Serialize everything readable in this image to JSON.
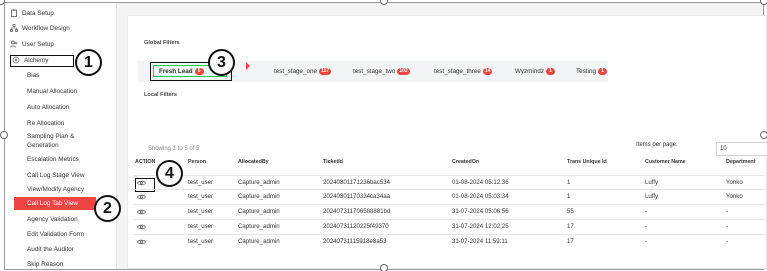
{
  "sidebar": {
    "top_items": [
      {
        "label": "Data Setup",
        "icon": "clipboard-icon"
      },
      {
        "label": "Workflow Design",
        "icon": "workflow-icon"
      },
      {
        "label": "User Setup",
        "icon": "users-icon"
      },
      {
        "label": "Alchemy",
        "icon": "alchemy-icon"
      }
    ],
    "sub_items": [
      "Bias",
      "Manual Allocation",
      "Auto Allocation",
      "Re Allocation",
      "Sampling Plan &",
      "Generation",
      "Escalation Metrics",
      "Call Log Stage View",
      "View/Modify Agency",
      "Call Log Tab View",
      "Agency Validation",
      "Edit Validation Form",
      "Audit the Auditor",
      "Skip Reason"
    ]
  },
  "main": {
    "global_filters_label": "Global Filters",
    "local_filters_label": "Local Filters",
    "chips": [
      {
        "label": "Fresh Lead",
        "count": "5"
      },
      {
        "label": "test_stage_one",
        "count": "117"
      },
      {
        "label": "test_stage_two",
        "count": "102"
      },
      {
        "label": "test_stage_three",
        "count": "14"
      },
      {
        "label": "Wyzmindz",
        "count": "1"
      },
      {
        "label": "Testing",
        "count": "1"
      }
    ],
    "showing": "Showing 1 to 5 of 5",
    "items_per_page_label": "Items per page:",
    "items_per_page_value": "10"
  },
  "table": {
    "headers": [
      "ACTION",
      "Person",
      "AllocatedBy",
      "TicketId",
      "CreatedOn",
      "Trans Unique Id",
      "Customer Name",
      "Department"
    ],
    "rows": [
      {
        "person": "test_user",
        "allocated_by": "Capture_admin",
        "ticket": "20240801171236bac534",
        "created": "01-08-2024 05:12:36",
        "trans": "1",
        "customer": "Luffy",
        "dept": "Yonko"
      },
      {
        "person": "test_user",
        "allocated_by": "Capture_admin",
        "ticket": "20240801170334ca34aa",
        "created": "01-08-2024 05:03:34",
        "trans": "1",
        "customer": "Luffy",
        "dept": "Yonko"
      },
      {
        "person": "test_user",
        "allocated_by": "Capture_admin",
        "ticket": "202407311706588881bd",
        "created": "31-07-2024 05:06:56",
        "trans": "55",
        "customer": "-",
        "dept": "-"
      },
      {
        "person": "test_user",
        "allocated_by": "Capture_admin",
        "ticket": "20240731120225f49370",
        "created": "31-07-2024 12:02:25",
        "trans": "17",
        "customer": "-",
        "dept": "-"
      },
      {
        "person": "test_user",
        "allocated_by": "Capture_admin",
        "ticket": "2024073111591​8e8a53",
        "created": "31-07-2024 11:59:11",
        "trans": "17",
        "customer": "-",
        "dept": "-"
      }
    ]
  },
  "callouts": [
    "1",
    "2",
    "3",
    "4"
  ],
  "colors": {
    "accent": "#ef4444",
    "selected_chip": "#22c55e"
  }
}
